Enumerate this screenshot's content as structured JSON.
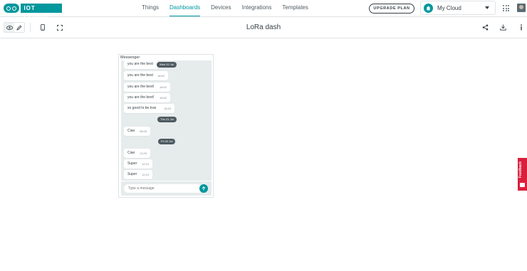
{
  "header": {
    "logo_text": "IOT CLOUD",
    "nav": [
      "Things",
      "Dashboards",
      "Devices",
      "Integrations",
      "Templates"
    ],
    "active_nav": "Dashboards",
    "upgrade_label": "UPGRADE PLAN",
    "cloud_label": "My Cloud"
  },
  "toolbar": {
    "title": "LoRa dash",
    "icons": [
      "eye-icon",
      "pencil-icon",
      "phone-icon",
      "fullscreen-icon",
      "share-icon",
      "download-icon",
      "info-icon"
    ]
  },
  "widget": {
    "title": "Messenger",
    "messages": [
      {
        "text": "you are the best",
        "date": "Wed 20 Jul"
      },
      {
        "text": "you are the best",
        "time": "18:52"
      },
      {
        "text": "you are the best!",
        "time": "18:52"
      },
      {
        "text": "you are the best!",
        "time": "18:52"
      },
      {
        "text": "so good to be true",
        "time": "18:53"
      },
      {
        "date": "Thu 21 Jul"
      },
      {
        "text": "Ciao",
        "time": "08:09"
      },
      {
        "date": "Fri 22 Jul"
      },
      {
        "text": "Ciao",
        "time": "12:09"
      },
      {
        "text": "Super",
        "time": "12:10"
      },
      {
        "text": "Super",
        "time": "12:10"
      }
    ],
    "input_placeholder": "Type a message"
  },
  "feedback": {
    "label": "Feedback"
  },
  "colors": {
    "accent": "#00979d",
    "feedback": "#da1f3d",
    "chat_bg": "#e6ebec"
  }
}
